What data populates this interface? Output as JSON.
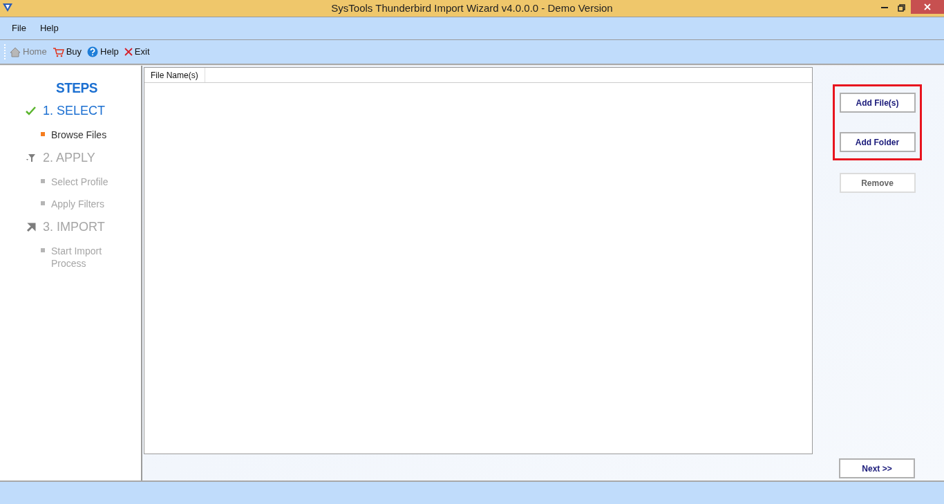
{
  "window": {
    "title": "SysTools Thunderbird Import Wizard v4.0.0.0 - Demo Version"
  },
  "menu": [
    "File",
    "Help"
  ],
  "toolbar": [
    {
      "kind": "home",
      "label": "Home",
      "disabled": true
    },
    {
      "kind": "buy",
      "label": "Buy",
      "disabled": false
    },
    {
      "kind": "help",
      "label": "Help",
      "disabled": false
    },
    {
      "kind": "exit",
      "label": "Exit",
      "disabled": false
    }
  ],
  "steps_title": "STEPS",
  "steps": [
    {
      "kind": "check",
      "label": "1. SELECT",
      "active": true,
      "children": [
        {
          "label": "Browse Files",
          "selected": true
        }
      ]
    },
    {
      "kind": "filter",
      "label": "2. APPLY",
      "active": false,
      "children": [
        {
          "label": "Select Profile",
          "selected": false
        },
        {
          "label": "Apply Filters",
          "selected": false
        }
      ]
    },
    {
      "kind": "arrow",
      "label": "3. IMPORT",
      "active": false,
      "children": [
        {
          "label": "Start Import Process",
          "selected": false
        }
      ]
    }
  ],
  "file_list": {
    "columns": [
      "File Name(s)"
    ]
  },
  "highlighted_buttons": [
    {
      "label": "Add File(s)",
      "disabled": false
    },
    {
      "label": "Add Folder",
      "disabled": false
    }
  ],
  "buttons": [
    {
      "label": "Remove",
      "disabled": true
    }
  ],
  "next_button": "Next >>"
}
